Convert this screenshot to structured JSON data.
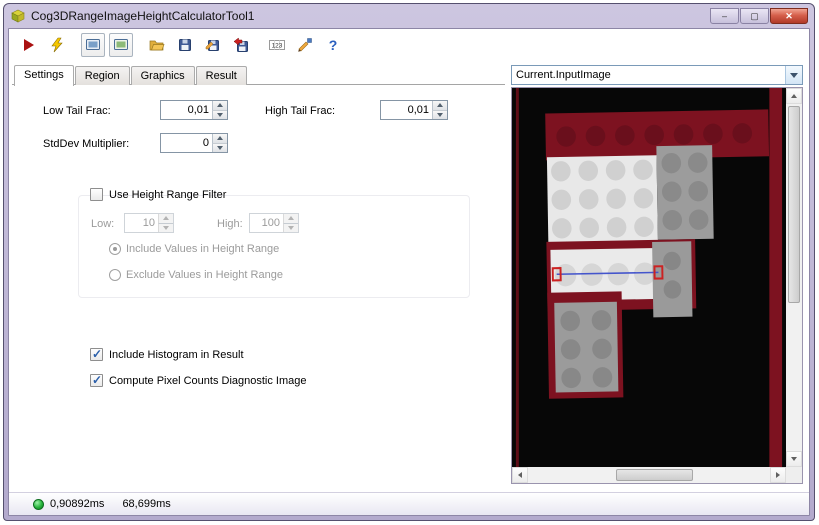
{
  "window": {
    "title": "Cog3DRangeImageHeightCalculatorTool1",
    "minimize_glyph": "–",
    "maximize_glyph": "▢",
    "close_glyph": "✕"
  },
  "toolbar": {
    "pixel_label": "123",
    "help_glyph": "?"
  },
  "tabs": {
    "items": [
      {
        "label": "Settings"
      },
      {
        "label": "Region"
      },
      {
        "label": "Graphics"
      },
      {
        "label": "Result"
      }
    ]
  },
  "settings": {
    "low_tail_frac": {
      "label": "Low Tail Frac:",
      "value": "0,01"
    },
    "high_tail_frac": {
      "label": "High Tail Frac:",
      "value": "0,01"
    },
    "stddev_multiplier": {
      "label": "StdDev Multiplier:",
      "value": "0"
    },
    "height_range_filter": {
      "label": "Use Height Range Filter",
      "checked": false
    },
    "low": {
      "label": "Low:",
      "value": "10"
    },
    "high": {
      "label": "High:",
      "value": "100"
    },
    "include_values": {
      "label": "Include Values in Height Range",
      "selected": true
    },
    "exclude_values": {
      "label": "Exclude Values in Height Range",
      "selected": false
    },
    "include_histogram": {
      "label": "Include Histogram in Result",
      "checked": true
    },
    "compute_pixel_counts": {
      "label": "Compute Pixel Counts Diagnostic Image",
      "checked": true
    }
  },
  "image_panel": {
    "selected_record": "Current.InputImage"
  },
  "status": {
    "execution_time": "0,90892ms",
    "total_time": "68,699ms"
  },
  "colors": {
    "chrome": "#b8aed4",
    "maroon": "#7d1220",
    "maroon_dark": "#650e1a",
    "block_light": "#e9e9e9",
    "block_gray": "#9c9c9c",
    "measure_line": "#4455cc",
    "handle_red": "#cc2222",
    "led_green": "#27b43c"
  }
}
